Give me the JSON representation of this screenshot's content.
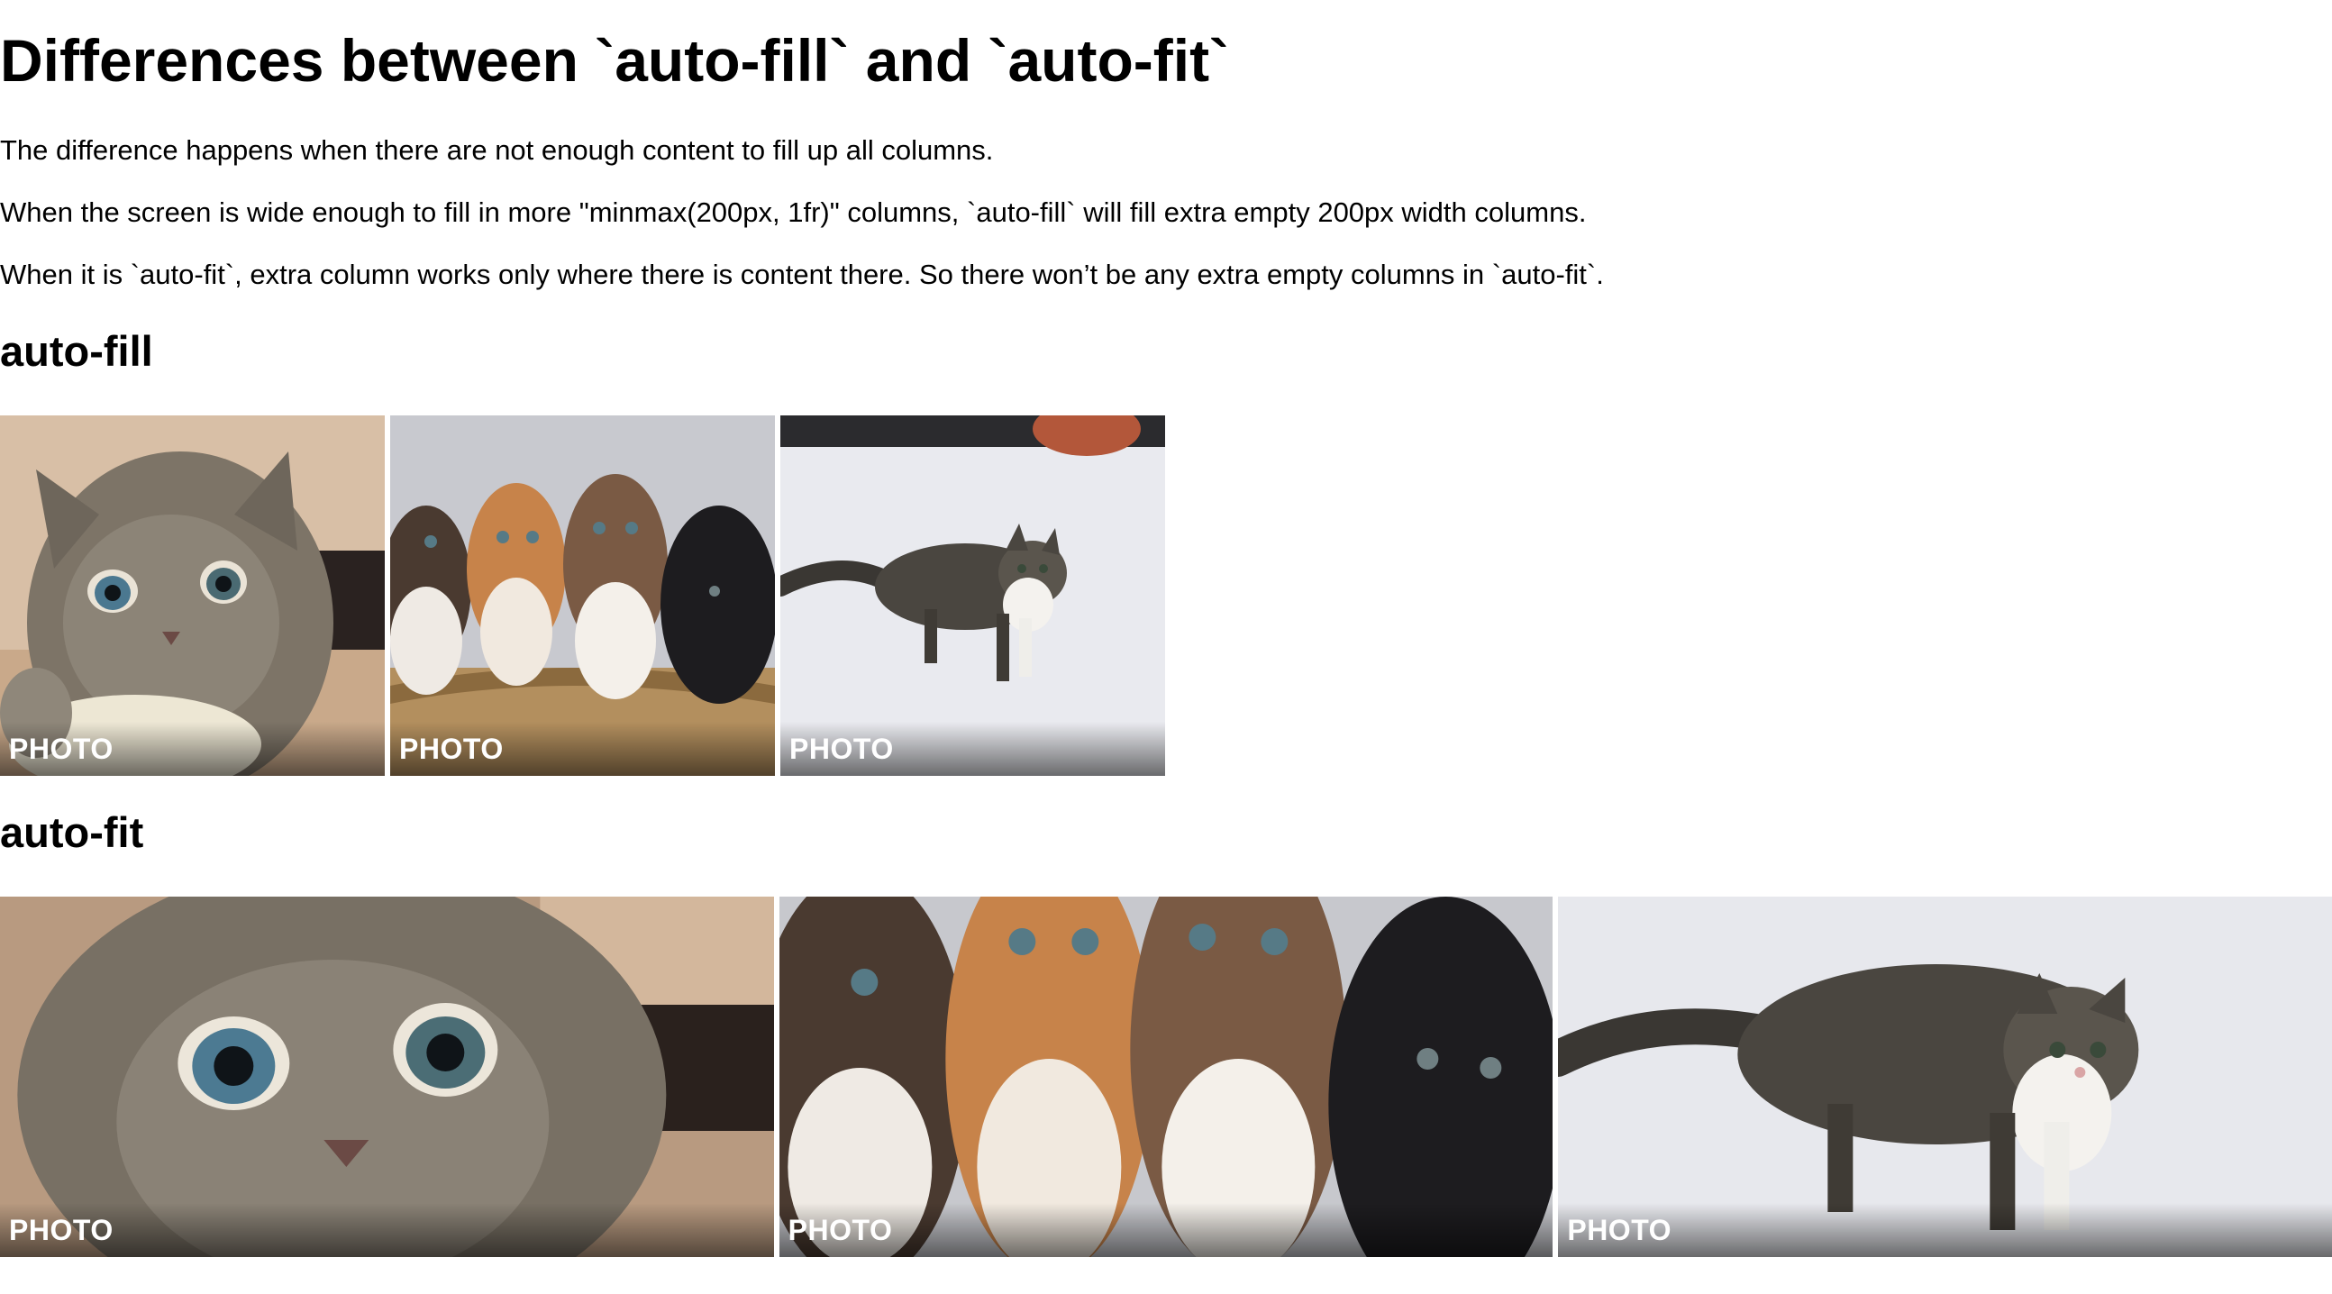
{
  "page": {
    "title": "Differences between `auto-fill` and `auto-fit`",
    "paragraphs": [
      "The difference happens when there are not enough content to fill up all columns.",
      "When the screen is wide enough to fill in more \"minmax(200px, 1fr)\" columns, `auto-fill` will fill extra empty 200px width columns.",
      "When it is `auto-fit`, extra column works only where there is content there. So there won’t be any extra empty columns in `auto-fit`."
    ]
  },
  "sections": {
    "auto_fill": {
      "heading": "auto-fill",
      "tiles": [
        {
          "label": "PHOTO",
          "image": "gray-kitten-closeup"
        },
        {
          "label": "PHOTO",
          "image": "four-kittens-in-basket"
        },
        {
          "label": "PHOTO",
          "image": "tabby-kitten-in-snow"
        }
      ]
    },
    "auto_fit": {
      "heading": "auto-fit",
      "tiles": [
        {
          "label": "PHOTO",
          "image": "gray-kitten-closeup"
        },
        {
          "label": "PHOTO",
          "image": "four-kittens-in-basket"
        },
        {
          "label": "PHOTO",
          "image": "tabby-kitten-in-snow"
        }
      ]
    }
  },
  "colors": {
    "text": "#000000",
    "background": "#ffffff",
    "label": "#ffffff"
  }
}
